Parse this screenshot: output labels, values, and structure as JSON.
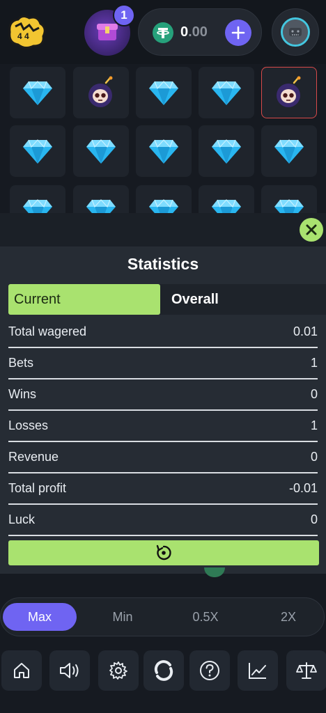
{
  "header": {
    "promo_badge": "1",
    "balance_int": "0",
    "balance_dec": ".00",
    "currency_icon": "tether-icon"
  },
  "grid": {
    "rows": [
      [
        "gem",
        "bomb",
        "gem",
        "gem",
        "bomb-selected"
      ],
      [
        "gem",
        "gem",
        "gem",
        "gem",
        "gem"
      ],
      [
        "gem",
        "gem",
        "gem",
        "gem",
        "gem"
      ]
    ]
  },
  "stats": {
    "title": "Statistics",
    "tab_current": "Current",
    "tab_overall": "Overall",
    "rows": [
      {
        "label": "Total wagered",
        "value": "0.01"
      },
      {
        "label": "Bets",
        "value": "1"
      },
      {
        "label": "Wins",
        "value": "0"
      },
      {
        "label": "Losses",
        "value": "1"
      },
      {
        "label": "Revenue",
        "value": "0"
      },
      {
        "label": "Total profit",
        "value": "-0.01"
      },
      {
        "label": "Luck",
        "value": "0"
      }
    ]
  },
  "multipliers": {
    "max": "Max",
    "min": "Min",
    "half": "0.5X",
    "double": "2X"
  },
  "colors": {
    "accent_green": "#a9e26f",
    "accent_purple": "#6f64f2",
    "bomb_border": "#d84a4a"
  }
}
